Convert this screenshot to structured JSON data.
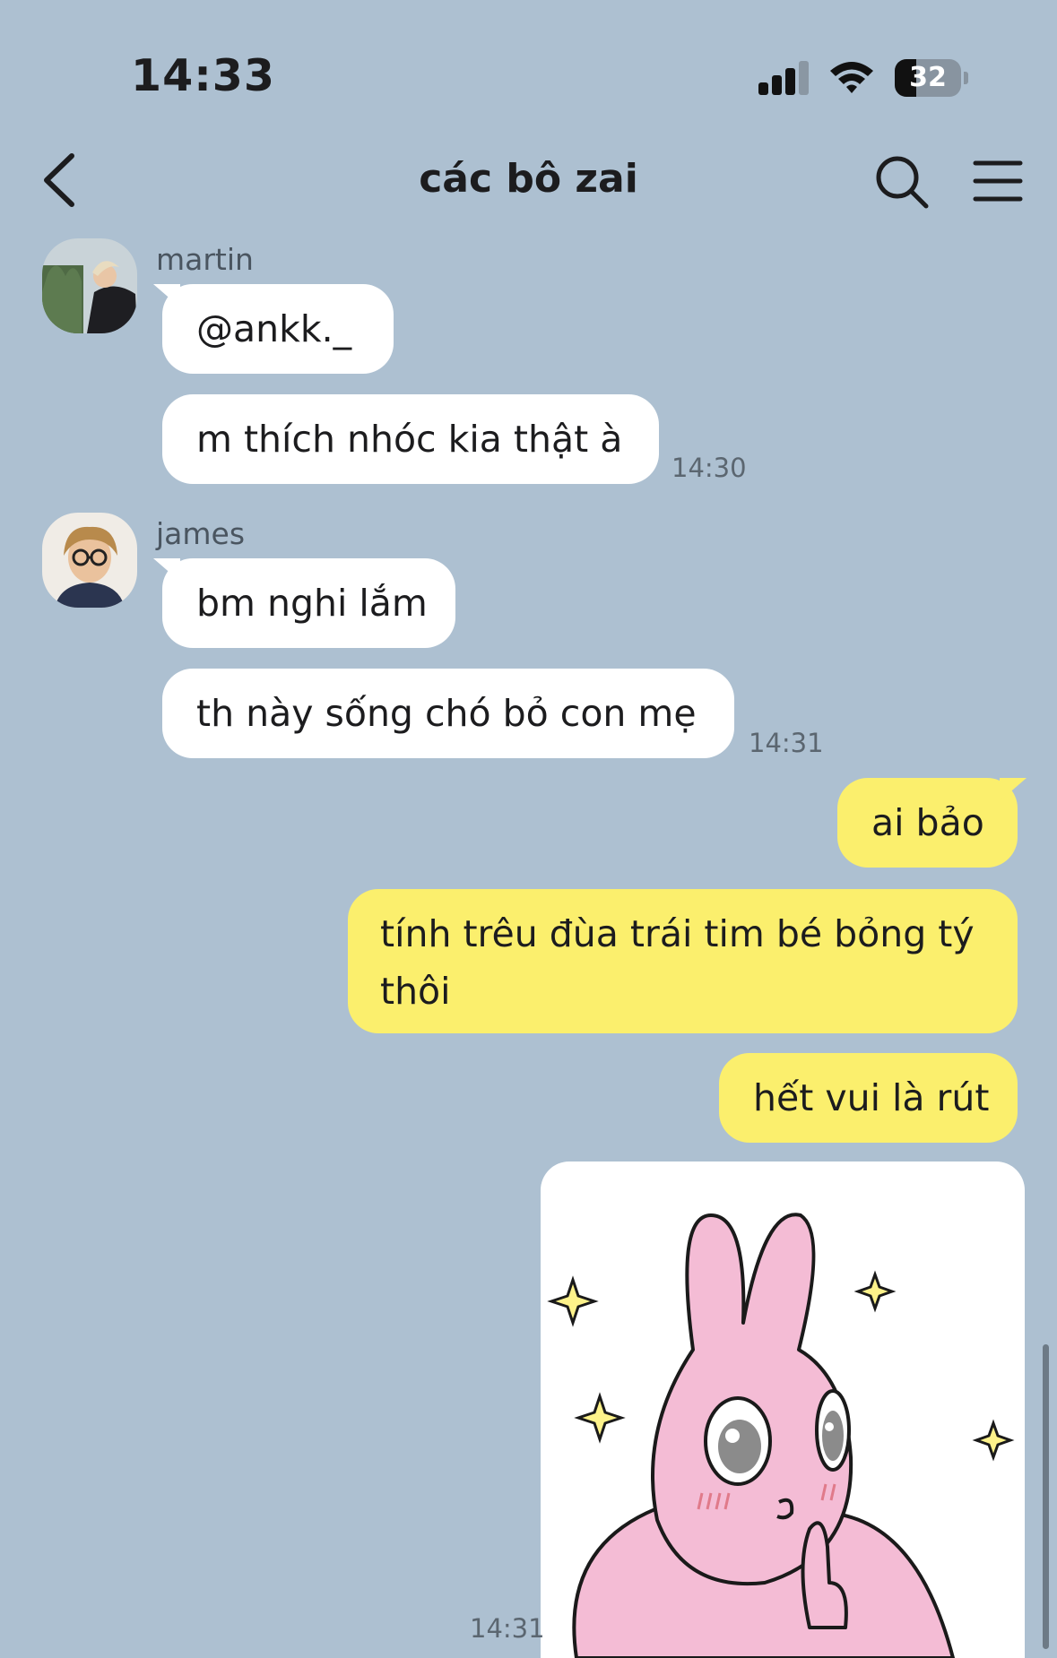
{
  "status_bar": {
    "time": "14:33",
    "battery_level": "32",
    "signal_bars": 3
  },
  "header": {
    "title": "các bô zai",
    "back_icon": "chevron-left-icon",
    "search_icon": "search-icon",
    "menu_icon": "hamburger-menu-icon"
  },
  "messages": {
    "martin": {
      "name": "martin",
      "lines": [
        "@ankk._",
        "m thích nhóc kia thật à"
      ],
      "time": "14:30"
    },
    "james": {
      "name": "james",
      "lines": [
        "bm nghi lắm",
        "th này sống chó bỏ con mẹ"
      ],
      "time": "14:31"
    },
    "me": {
      "lines": [
        "ai bảo",
        "tính trêu đùa trái tim bé bỏng tý thôi",
        "hết vui là rút"
      ],
      "sticker": "pink-rabbit-sticker",
      "time": "14:31"
    }
  },
  "colors": {
    "background": "#adc0d1",
    "incoming_bubble": "#ffffff",
    "outgoing_bubble": "#fbef6d",
    "sticker_pink": "#f4bcd5"
  }
}
